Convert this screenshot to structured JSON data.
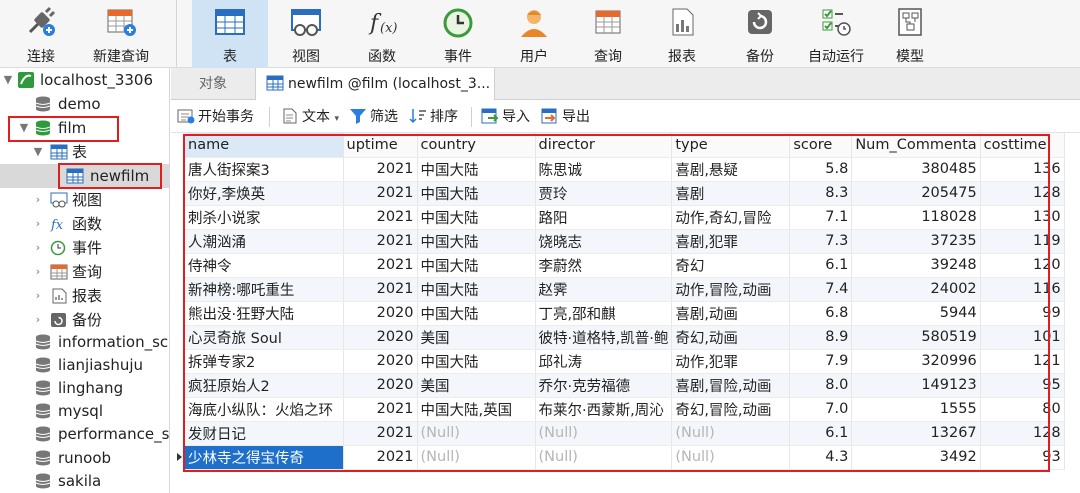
{
  "toolbar": {
    "connect": "连接",
    "new_query": "新建查询",
    "buttons": [
      "表",
      "视图",
      "函数",
      "事件",
      "用户",
      "查询",
      "报表",
      "备份",
      "自动运行",
      "模型"
    ],
    "active": "表"
  },
  "tree": {
    "connection": "localhost_3306",
    "databases_before": [
      "demo"
    ],
    "open_db": "film",
    "tables_group": "表",
    "selected_table": "newfilm",
    "groups": [
      "视图",
      "函数",
      "事件",
      "查询",
      "报表",
      "备份"
    ],
    "databases_after": [
      "information_sch",
      "lianjiashuju",
      "linghang",
      "mysql",
      "performance_sc",
      "runoob",
      "sakila"
    ]
  },
  "tabs": {
    "objects": "对象",
    "active": "newfilm @film (localhost_3..."
  },
  "subtoolbar": {
    "begin_transaction": "开始事务",
    "text": "文本",
    "filter": "筛选",
    "sort": "排序",
    "import": "导入",
    "export": "导出"
  },
  "grid": {
    "columns": [
      "name",
      "uptime",
      "country",
      "director",
      "type",
      "score",
      "Num_Commenta",
      "costtime"
    ],
    "rows": [
      [
        "唐人街探案3",
        "2021",
        "中国大陆",
        "陈思诚",
        "喜剧,悬疑",
        "5.8",
        "380485",
        "136"
      ],
      [
        "你好,李焕英",
        "2021",
        "中国大陆",
        "贾玲",
        "喜剧",
        "8.3",
        "205475",
        "128"
      ],
      [
        "刺杀小说家",
        "2021",
        "中国大陆",
        "路阳",
        "动作,奇幻,冒险",
        "7.1",
        "118028",
        "130"
      ],
      [
        "人潮汹涌",
        "2021",
        "中国大陆",
        "饶晓志",
        "喜剧,犯罪",
        "7.3",
        "37235",
        "119"
      ],
      [
        "侍神令",
        "2021",
        "中国大陆",
        "李蔚然",
        "奇幻",
        "6.1",
        "39248",
        "120"
      ],
      [
        "新神榜:哪吒重生",
        "2021",
        "中国大陆",
        "赵霁",
        "动作,冒险,动画",
        "7.4",
        "24002",
        "116"
      ],
      [
        "熊出没·狂野大陆",
        "2020",
        "中国大陆",
        "丁亮,邵和麒",
        "喜剧,动画",
        "6.8",
        "5944",
        "99"
      ],
      [
        "心灵奇旅 Soul",
        "2020",
        "美国",
        "彼特·道格特,凯普·鲍",
        "奇幻,动画",
        "8.9",
        "580519",
        "101"
      ],
      [
        "拆弹专家2",
        "2020",
        "中国大陆",
        "邱礼涛",
        "动作,犯罪",
        "7.9",
        "320996",
        "121"
      ],
      [
        "疯狂原始人2",
        "2020",
        "美国",
        "乔尔·克劳福德",
        "喜剧,冒险,动画",
        "8.0",
        "149123",
        "95"
      ],
      [
        "海底小纵队：火焰之环",
        "2021",
        "中国大陆,英国",
        "布莱尔·西蒙斯,周沁",
        "奇幻,冒险,动画",
        "7.0",
        "1555",
        "80"
      ],
      [
        "发财日记",
        "2021",
        "(Null)",
        "(Null)",
        "(Null)",
        "6.1",
        "13267",
        "128"
      ],
      [
        "少林寺之得宝传奇",
        "2021",
        "(Null)",
        "(Null)",
        "(Null)",
        "4.3",
        "3492",
        "93"
      ]
    ]
  },
  "colors": {
    "accent": "#1e6fc9",
    "highlight_border": "#e11d1d",
    "active_tool": "#cfe3f5"
  }
}
